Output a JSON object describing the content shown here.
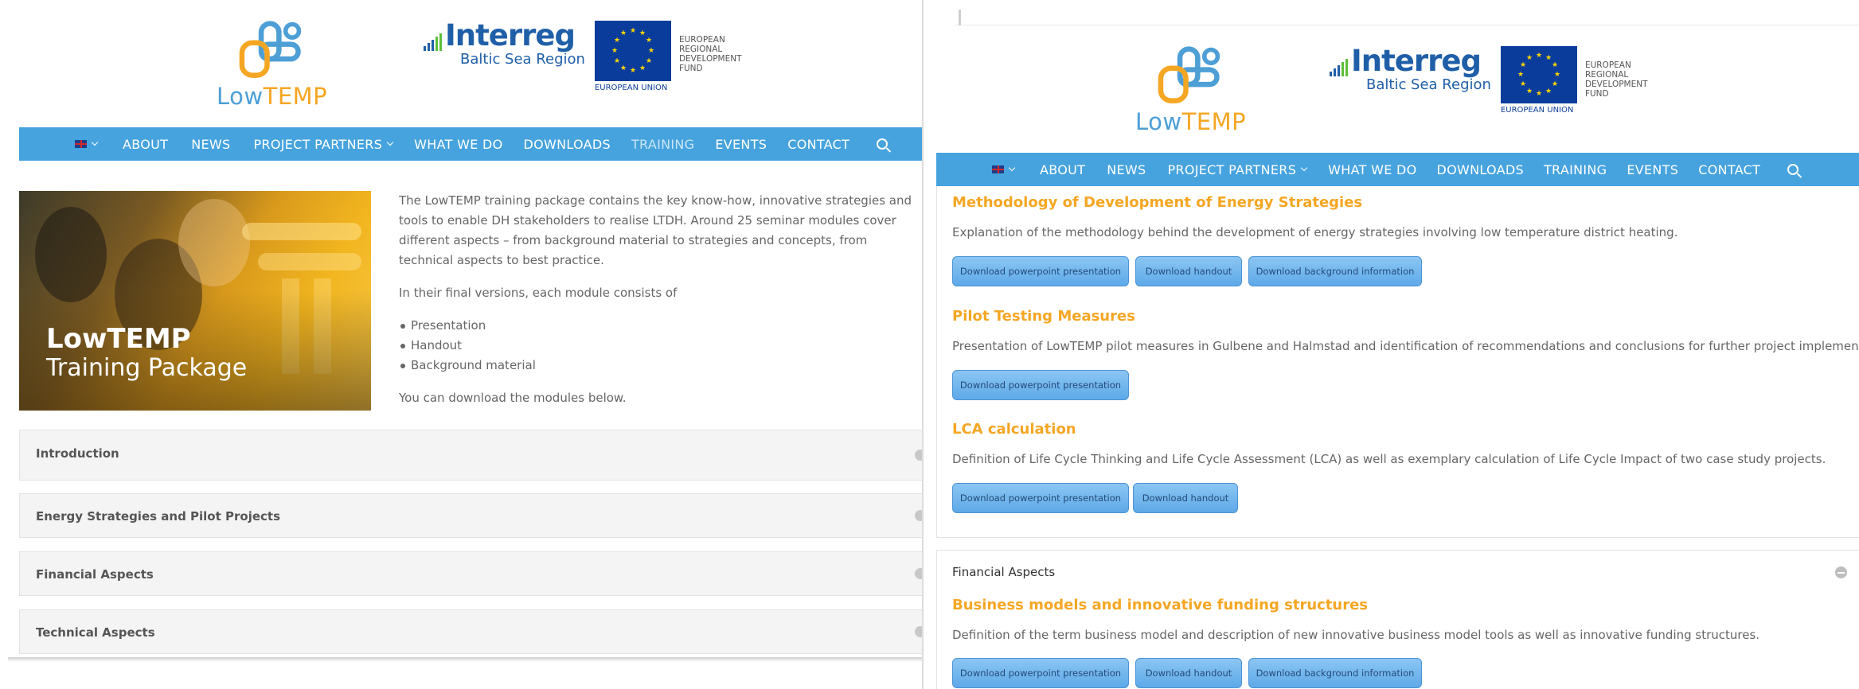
{
  "logo": {
    "low": "Low",
    "temp": "TEMP"
  },
  "interreg": {
    "name": "Interreg",
    "sub": "Baltic Sea Region",
    "eu_caption": "EUROPEAN UNION",
    "fund_lines": [
      "EUROPEAN",
      "REGIONAL",
      "DEVELOPMENT",
      "FUND"
    ]
  },
  "nav": {
    "items": [
      "ABOUT",
      "NEWS",
      "PROJECT PARTNERS",
      "WHAT WE DO",
      "DOWNLOADS",
      "TRAINING",
      "EVENTS",
      "CONTACT"
    ],
    "active_left": "TRAINING"
  },
  "left": {
    "hero": {
      "title": "LowTEMP",
      "subtitle": "Training Package"
    },
    "intro": {
      "p1": "The LowTEMP training package contains the key know-how, innovative strategies and tools to enable DH stakeholders to realise LTDH. Around 25 seminar modules cover different aspects – from background material to strategies and concepts, from technical aspects to best practice.",
      "p2": "In their final versions, each module consists of",
      "list": [
        "Presentation",
        "Handout",
        "Background material"
      ],
      "p3": "You can download the modules below."
    },
    "accordions": [
      "Introduction",
      "Energy Strategies and Pilot Projects",
      "Financial Aspects",
      "Technical Aspects"
    ]
  },
  "right": {
    "sections": [
      {
        "title": "Methodology of Development of Energy Strategies",
        "desc": "Explanation of the methodology behind the development of energy strategies involving low temperature district heating.",
        "buttons": [
          "Download powerpoint presentation",
          "Download handout",
          "Download background information"
        ]
      },
      {
        "title": "Pilot Testing Measures",
        "desc": "Presentation of LowTEMP pilot measures in Gulbene and Halmstad and identification of recommendations and conclusions for further project implementations.",
        "buttons": [
          "Download powerpoint presentation"
        ]
      },
      {
        "title": "LCA calculation",
        "desc": "Definition of Life Cycle Thinking and Life Cycle Assessment (LCA) as well as exemplary calculation of Life Cycle Impact of two case study projects.",
        "buttons": [
          "Download powerpoint presentation",
          "Download handout"
        ]
      }
    ],
    "financial": {
      "header": "Financial Aspects",
      "title": "Business models and innovative funding structures",
      "desc": "Definition of the term business model and description of new innovative business model tools as well as innovative funding structures.",
      "buttons": [
        "Download powerpoint presentation",
        "Download handout",
        "Download background information"
      ]
    }
  },
  "colors": {
    "nav": "#46a3de",
    "accent": "#f5a623",
    "button": "#6fb4ec"
  }
}
